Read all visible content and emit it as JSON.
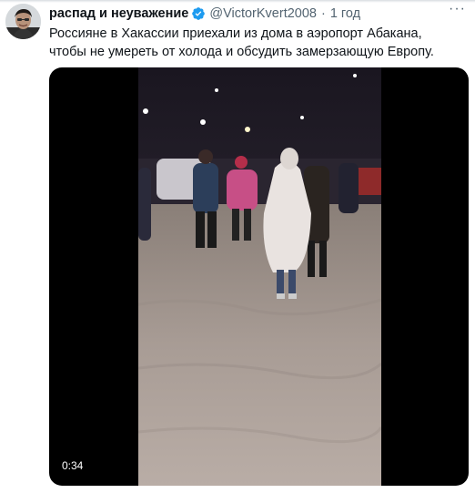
{
  "user": {
    "display_name": "распад и неуважение",
    "handle": "@VictorKvert2008",
    "separator": "·",
    "time": "1 год",
    "verified": true
  },
  "tweet": {
    "text": "Россияне в Хакассии приехали из дома в аэропорт Абакана, чтобы не умереть от холода и обсудить замерзающую Европу."
  },
  "media": {
    "type": "video",
    "duration": "0:34"
  },
  "icons": {
    "verified": "verified-badge-icon",
    "more": "more-options-icon"
  },
  "colors": {
    "verified": "#1d9bf0",
    "secondary_text": "#536471",
    "primary_text": "#0f1419"
  }
}
